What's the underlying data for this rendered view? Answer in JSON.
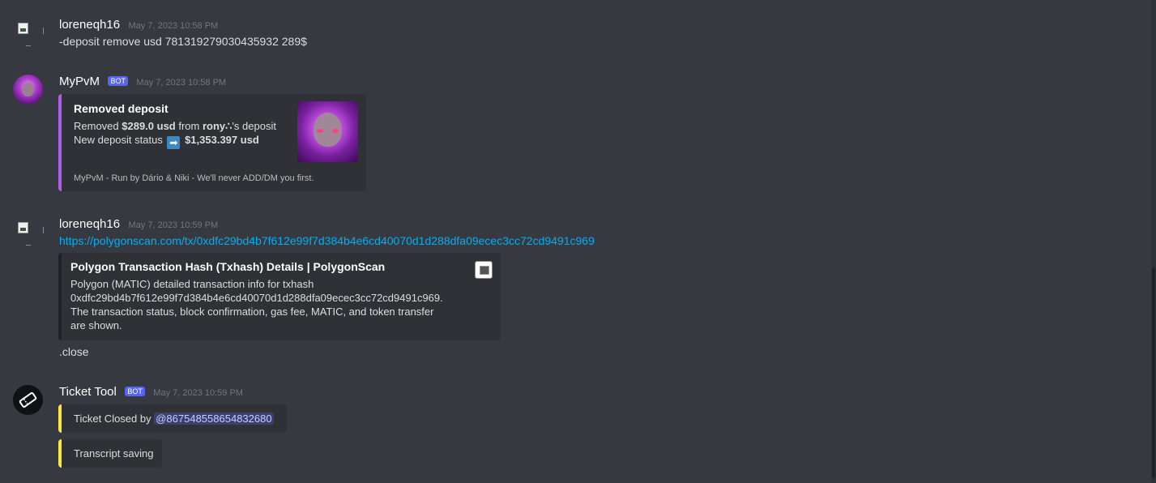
{
  "messages": [
    {
      "username": "loreneqh16",
      "timestamp": "May 7, 2023 10:58 PM",
      "text": "-deposit remove usd 781319279030435932 289$"
    },
    {
      "username": "MyPvM",
      "bot_tag": "BOT",
      "timestamp": "May 7, 2023 10:58 PM",
      "embed": {
        "title": "Removed deposit",
        "line1_pre": "Removed ",
        "line1_amount": "$289.0 usd",
        "line1_mid": " from ",
        "line1_user": "rony∴",
        "line1_post": "'s deposit",
        "line2_pre": "New deposit status ",
        "line2_arrow": "➡",
        "line2_amount": "$1,353.397 usd",
        "footer": "MyPvM - Run by Dário & Niki - We'll never ADD/DM you first.",
        "accent": "#b05ee8"
      }
    },
    {
      "username": "loreneqh16",
      "timestamp": "May 7, 2023 10:59 PM",
      "link": "https://polygonscan.com/tx/0xdfc29bd4b7f612e99f7d384b4e6cd40070d1d288dfa09ecec3cc72cd9491c969",
      "embed": {
        "title": "Polygon Transaction Hash (Txhash) Details | PolygonScan",
        "desc_lines": [
          "Polygon (MATIC) detailed transaction info for txhash",
          "0xdfc29bd4b7f612e99f7d384b4e6cd40070d1d288dfa09ecec3cc72cd9491c969.",
          "The transaction status, block confirmation, gas fee, MATIC, and token transfer",
          "are shown."
        ]
      },
      "text2": ".close"
    },
    {
      "username": "Ticket Tool",
      "bot_tag": "BOT",
      "timestamp": "May 7, 2023 10:59 PM",
      "embed1": {
        "text_pre": "Ticket Closed by ",
        "mention": "@867548558654832680",
        "accent": "#fbe83c"
      },
      "embed2": {
        "text": "Transcript saving",
        "accent": "#fbe83c"
      }
    }
  ],
  "colors": {
    "background": "#36393f",
    "link": "#00aff4",
    "bot_tag": "#5865f2"
  }
}
